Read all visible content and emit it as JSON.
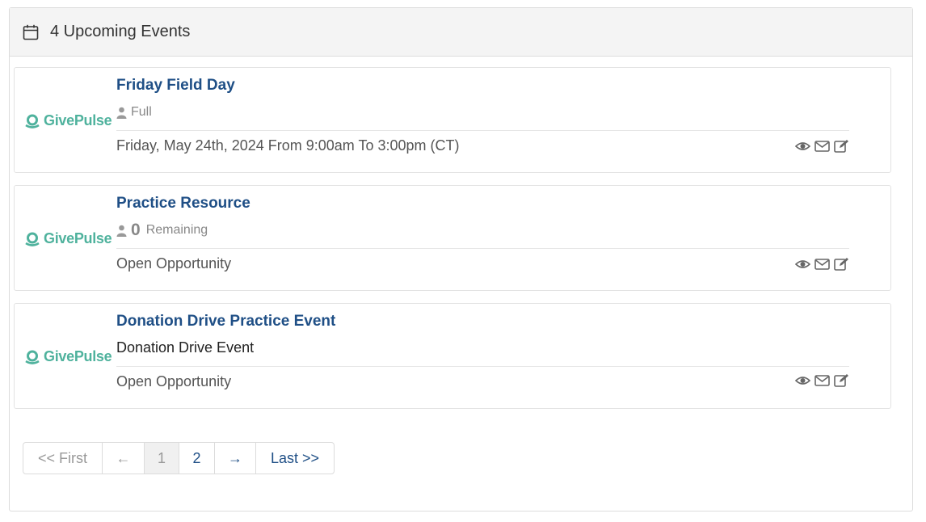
{
  "header": {
    "title": "4 Upcoming Events"
  },
  "events": [
    {
      "title": "Friday Field Day",
      "meta_label": "Full",
      "date": "Friday, May 24th, 2024 From 9:00am To 3:00pm (CT)"
    },
    {
      "title": "Practice Resource",
      "meta_count": "0",
      "meta_label": "Remaining",
      "date": "Open Opportunity"
    },
    {
      "title": "Donation Drive Practice Event",
      "description": "Donation Drive Event",
      "date": "Open Opportunity"
    }
  ],
  "logo_text": "GivePulse",
  "pagination": {
    "first": "<< First",
    "prev": "←",
    "page1": "1",
    "page2": "2",
    "next": "→",
    "last": "Last >>"
  },
  "colors": {
    "brand": "#4fb29d",
    "link": "#1f4f86"
  },
  "icons": [
    "calendar-icon",
    "user-icon",
    "eye-icon",
    "envelope-icon",
    "edit-icon"
  ]
}
